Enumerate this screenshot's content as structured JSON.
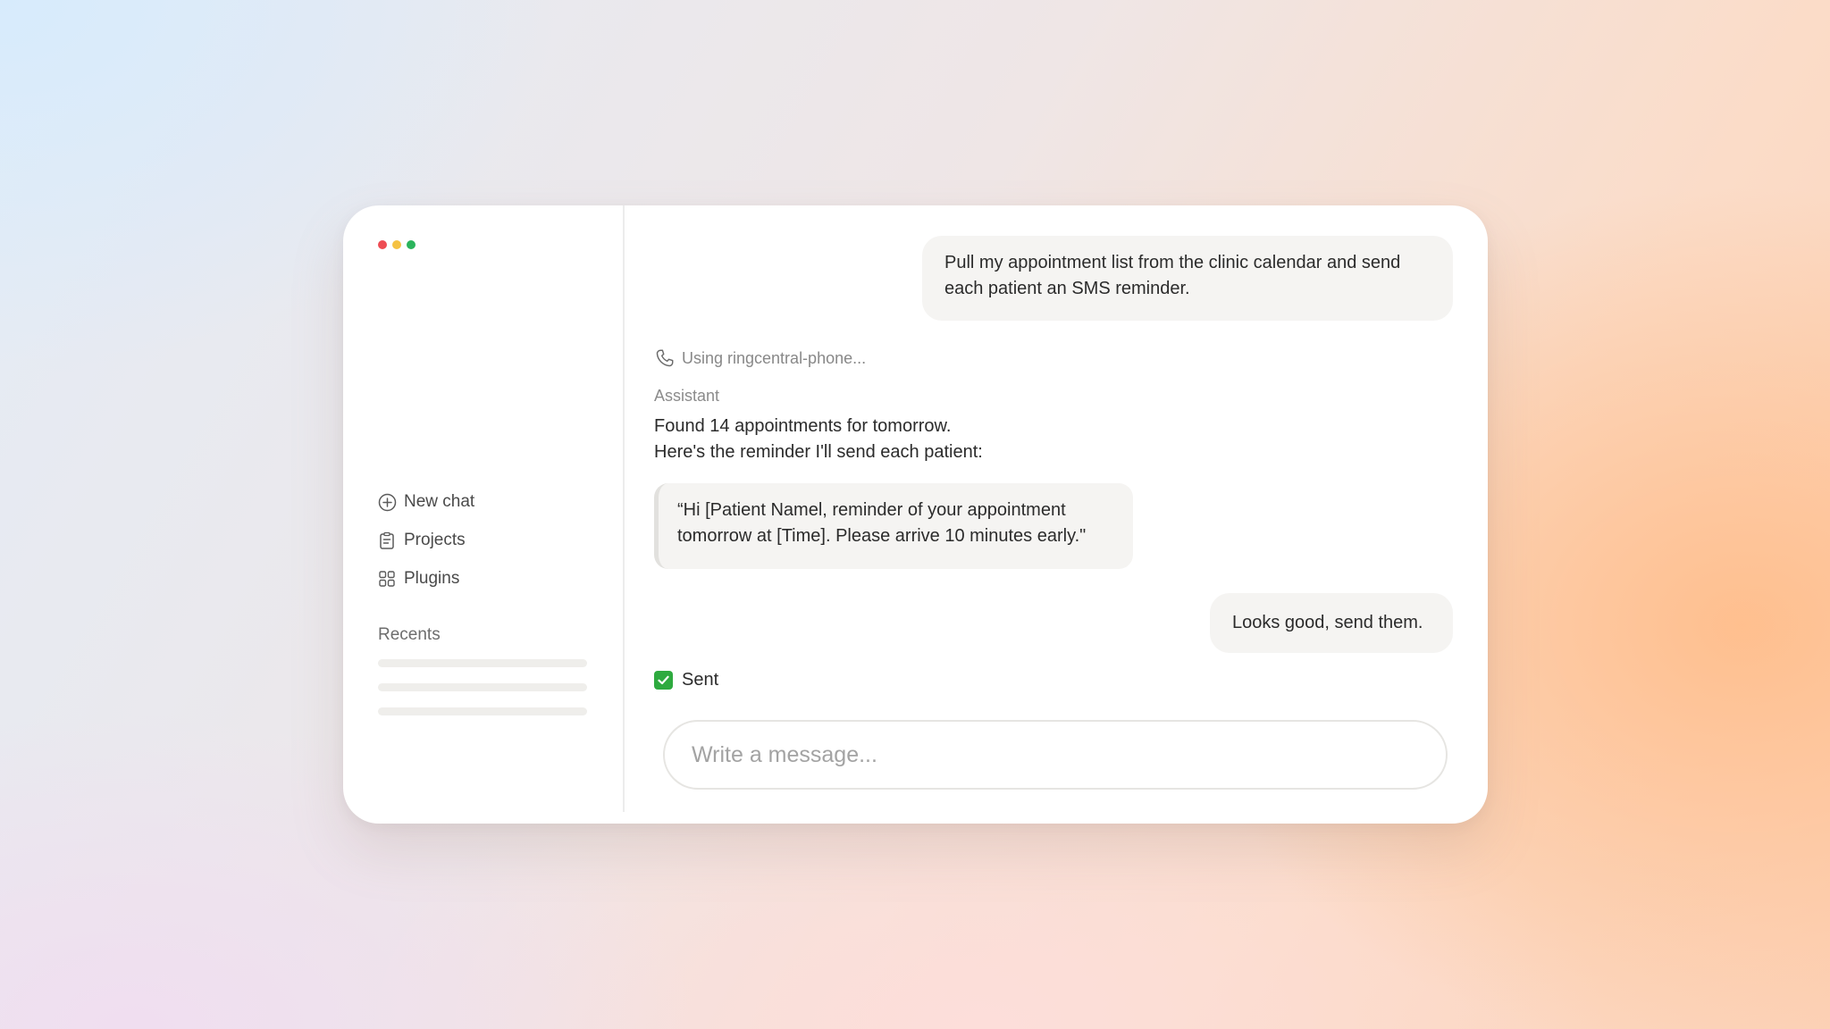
{
  "window": {
    "controls": [
      "close",
      "minimize",
      "maximize"
    ]
  },
  "sidebar": {
    "items": [
      {
        "label": "New chat",
        "icon": "plus-circle-icon"
      },
      {
        "label": "Projects",
        "icon": "clipboard-icon"
      },
      {
        "label": "Plugins",
        "icon": "grid-icon"
      }
    ],
    "recents_title": "Recents"
  },
  "chat": {
    "user_message_1": "Pull my appointment list from the clinic calendar and send each patient an SMS reminder.",
    "tool_use": "Using ringcentral-phone...",
    "tool_icon": "phone-icon",
    "assistant_label": "Assistant",
    "assistant_line_1": "Found 14 appointments for tomorrow.",
    "assistant_line_2": "Here's the reminder I'll send each patient:",
    "reminder_quote": "“Hi [Patient Namel, reminder of your appointment tomorrow at [Time]. Please arrive 10 minutes early.\"",
    "user_message_2": "Looks good, send them.",
    "status_icon": "check-box-icon",
    "status_text": "Sent"
  },
  "composer": {
    "placeholder": "Write a message..."
  },
  "colors": {
    "close": "#ee4d54",
    "minimize": "#f5c243",
    "maximize": "#2bb45c",
    "check": "#2eaa3f"
  }
}
